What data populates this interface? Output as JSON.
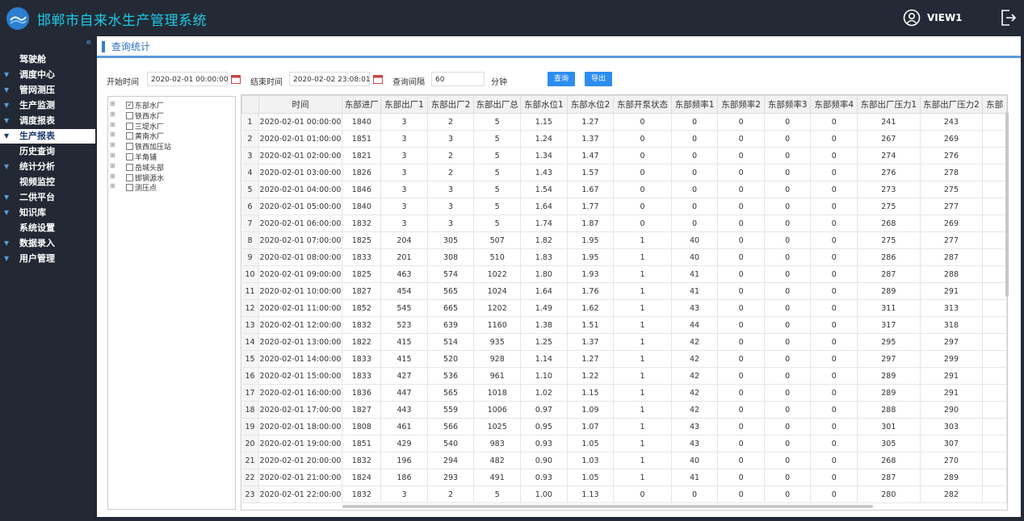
{
  "header": {
    "title": "邯郸市自来水生产管理系统",
    "user": "VIEW1"
  },
  "sidebar": {
    "collapse_glyph": "«",
    "items": [
      {
        "label": "驾驶舱",
        "arrow": false
      },
      {
        "label": "调度中心",
        "arrow": true
      },
      {
        "label": "管网测压",
        "arrow": true
      },
      {
        "label": "生产监测",
        "arrow": true
      },
      {
        "label": "调度报表",
        "arrow": true
      },
      {
        "label": "生产报表",
        "arrow": true,
        "active": true
      },
      {
        "label": "历史查询",
        "arrow": false
      },
      {
        "label": "统计分析",
        "arrow": true
      },
      {
        "label": "视频监控",
        "arrow": false
      },
      {
        "label": "二供平台",
        "arrow": true
      },
      {
        "label": "知识库",
        "arrow": true
      },
      {
        "label": "系统设置",
        "arrow": false
      },
      {
        "label": "数据录入",
        "arrow": true
      },
      {
        "label": "用户管理",
        "arrow": true
      }
    ]
  },
  "page": {
    "title": "查询统计"
  },
  "query": {
    "start_label": "开始时间",
    "start_value": "2020-02-01 00:00:00",
    "end_label": "结束时间",
    "end_value": "2020-02-02 23:08:01",
    "interval_label": "查询间隔",
    "interval_value": "60",
    "unit_label": "分钟",
    "search_button": "查询",
    "export_button": "导出"
  },
  "tree": [
    {
      "label": "东部水厂",
      "checked": true
    },
    {
      "label": "铁西水厂",
      "checked": false
    },
    {
      "label": "三堤水厂",
      "checked": false
    },
    {
      "label": "黄南水厂",
      "checked": false
    },
    {
      "label": "铁西加压站",
      "checked": false
    },
    {
      "label": "羊角铺",
      "checked": false
    },
    {
      "label": "岳城头部",
      "checked": false
    },
    {
      "label": "邯钢源水",
      "checked": false
    },
    {
      "label": "测压点",
      "checked": false
    }
  ],
  "table": {
    "columns": [
      "",
      "时间",
      "东部进厂",
      "东部出厂1",
      "东部出厂2",
      "东部出厂总",
      "东部水位1",
      "东部水位2",
      "东部开泵状态",
      "东部频率1",
      "东部频率2",
      "东部频率3",
      "东部频率4",
      "东部出厂压力1",
      "东部出厂压力2",
      "东部"
    ],
    "rows": [
      [
        "1",
        "2020-02-01 00:00:00",
        "1840",
        "3",
        "2",
        "5",
        "1.15",
        "1.27",
        "0",
        "0",
        "0",
        "0",
        "0",
        "241",
        "243"
      ],
      [
        "2",
        "2020-02-01 01:00:00",
        "1851",
        "3",
        "3",
        "5",
        "1.24",
        "1.37",
        "0",
        "0",
        "0",
        "0",
        "0",
        "267",
        "269"
      ],
      [
        "3",
        "2020-02-01 02:00:00",
        "1821",
        "3",
        "2",
        "5",
        "1.34",
        "1.47",
        "0",
        "0",
        "0",
        "0",
        "0",
        "274",
        "276"
      ],
      [
        "4",
        "2020-02-01 03:00:00",
        "1826",
        "3",
        "2",
        "5",
        "1.43",
        "1.57",
        "0",
        "0",
        "0",
        "0",
        "0",
        "276",
        "278"
      ],
      [
        "5",
        "2020-02-01 04:00:00",
        "1846",
        "3",
        "3",
        "5",
        "1.54",
        "1.67",
        "0",
        "0",
        "0",
        "0",
        "0",
        "273",
        "275"
      ],
      [
        "6",
        "2020-02-01 05:00:00",
        "1840",
        "3",
        "3",
        "5",
        "1.64",
        "1.77",
        "0",
        "0",
        "0",
        "0",
        "0",
        "275",
        "277"
      ],
      [
        "7",
        "2020-02-01 06:00:00",
        "1832",
        "3",
        "3",
        "5",
        "1.74",
        "1.87",
        "0",
        "0",
        "0",
        "0",
        "0",
        "268",
        "269"
      ],
      [
        "8",
        "2020-02-01 07:00:00",
        "1825",
        "204",
        "305",
        "507",
        "1.82",
        "1.95",
        "1",
        "40",
        "0",
        "0",
        "0",
        "275",
        "277"
      ],
      [
        "9",
        "2020-02-01 08:00:00",
        "1833",
        "201",
        "308",
        "510",
        "1.83",
        "1.95",
        "1",
        "40",
        "0",
        "0",
        "0",
        "286",
        "287"
      ],
      [
        "10",
        "2020-02-01 09:00:00",
        "1825",
        "463",
        "574",
        "1022",
        "1.80",
        "1.93",
        "1",
        "41",
        "0",
        "0",
        "0",
        "287",
        "288"
      ],
      [
        "11",
        "2020-02-01 10:00:00",
        "1827",
        "454",
        "565",
        "1024",
        "1.64",
        "1.76",
        "1",
        "41",
        "0",
        "0",
        "0",
        "289",
        "291"
      ],
      [
        "12",
        "2020-02-01 11:00:00",
        "1852",
        "545",
        "665",
        "1202",
        "1.49",
        "1.62",
        "1",
        "43",
        "0",
        "0",
        "0",
        "311",
        "313"
      ],
      [
        "13",
        "2020-02-01 12:00:00",
        "1832",
        "523",
        "639",
        "1160",
        "1.38",
        "1.51",
        "1",
        "44",
        "0",
        "0",
        "0",
        "317",
        "318"
      ],
      [
        "14",
        "2020-02-01 13:00:00",
        "1822",
        "415",
        "514",
        "935",
        "1.25",
        "1.37",
        "1",
        "42",
        "0",
        "0",
        "0",
        "295",
        "297"
      ],
      [
        "15",
        "2020-02-01 14:00:00",
        "1833",
        "415",
        "520",
        "928",
        "1.14",
        "1.27",
        "1",
        "42",
        "0",
        "0",
        "0",
        "297",
        "299"
      ],
      [
        "16",
        "2020-02-01 15:00:00",
        "1833",
        "427",
        "536",
        "961",
        "1.10",
        "1.22",
        "1",
        "42",
        "0",
        "0",
        "0",
        "289",
        "291"
      ],
      [
        "17",
        "2020-02-01 16:00:00",
        "1836",
        "447",
        "565",
        "1018",
        "1.02",
        "1.15",
        "1",
        "42",
        "0",
        "0",
        "0",
        "289",
        "291"
      ],
      [
        "18",
        "2020-02-01 17:00:00",
        "1827",
        "443",
        "559",
        "1006",
        "0.97",
        "1.09",
        "1",
        "42",
        "0",
        "0",
        "0",
        "288",
        "290"
      ],
      [
        "19",
        "2020-02-01 18:00:00",
        "1808",
        "461",
        "566",
        "1025",
        "0.95",
        "1.07",
        "1",
        "43",
        "0",
        "0",
        "0",
        "301",
        "303"
      ],
      [
        "20",
        "2020-02-01 19:00:00",
        "1851",
        "429",
        "540",
        "983",
        "0.93",
        "1.05",
        "1",
        "43",
        "0",
        "0",
        "0",
        "305",
        "307"
      ],
      [
        "21",
        "2020-02-01 20:00:00",
        "1832",
        "196",
        "294",
        "482",
        "0.90",
        "1.03",
        "1",
        "40",
        "0",
        "0",
        "0",
        "268",
        "270"
      ],
      [
        "22",
        "2020-02-01 21:00:00",
        "1824",
        "186",
        "293",
        "491",
        "0.93",
        "1.05",
        "1",
        "41",
        "0",
        "0",
        "0",
        "287",
        "289"
      ],
      [
        "23",
        "2020-02-01 22:00:00",
        "1832",
        "3",
        "2",
        "5",
        "1.00",
        "1.13",
        "0",
        "0",
        "0",
        "0",
        "0",
        "280",
        "282"
      ]
    ]
  },
  "colors": {
    "accent": "#2d8cf0",
    "brand": "#1ec8e6",
    "header_bg": "#232a35"
  }
}
